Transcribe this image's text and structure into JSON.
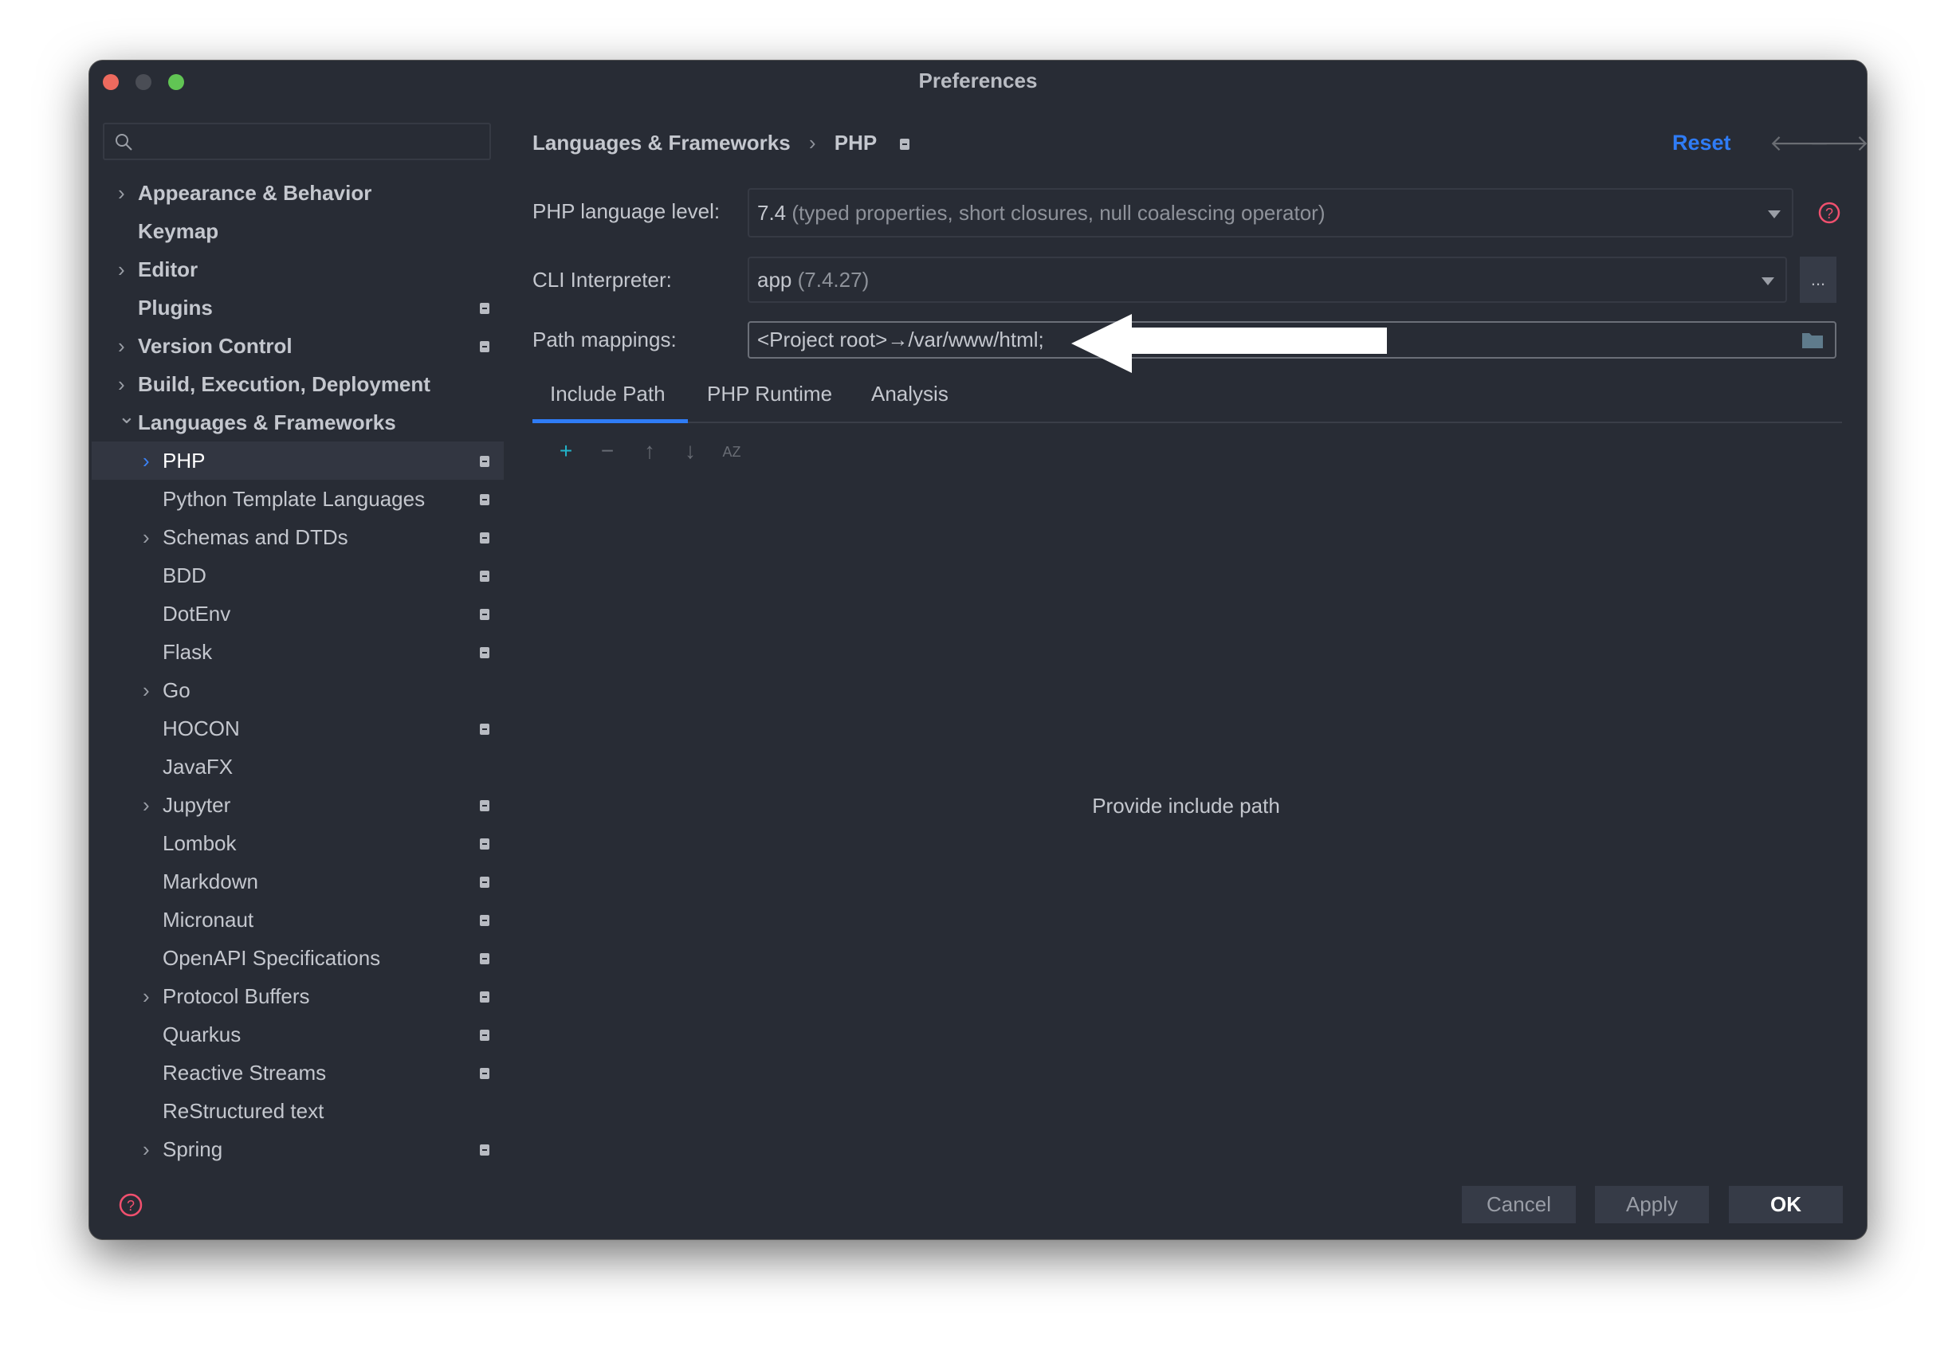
{
  "window": {
    "title": "Preferences"
  },
  "sidebar": {
    "search_placeholder": "",
    "items": [
      {
        "label": "Appearance & Behavior",
        "level": 0,
        "expander": "collapsed",
        "badge": false,
        "bold": true
      },
      {
        "label": "Keymap",
        "level": 0,
        "expander": "none",
        "badge": false,
        "bold": true
      },
      {
        "label": "Editor",
        "level": 0,
        "expander": "collapsed",
        "badge": false,
        "bold": true
      },
      {
        "label": "Plugins",
        "level": 0,
        "expander": "none",
        "badge": true,
        "bold": true
      },
      {
        "label": "Version Control",
        "level": 0,
        "expander": "collapsed",
        "badge": true,
        "bold": true
      },
      {
        "label": "Build, Execution, Deployment",
        "level": 0,
        "expander": "collapsed",
        "badge": false,
        "bold": true
      },
      {
        "label": "Languages & Frameworks",
        "level": 0,
        "expander": "expanded",
        "badge": false,
        "bold": true
      },
      {
        "label": "PHP",
        "level": 1,
        "expander": "collapsed",
        "badge": true,
        "selected": true
      },
      {
        "label": "Python Template Languages",
        "level": 1,
        "expander": "none",
        "badge": true
      },
      {
        "label": "Schemas and DTDs",
        "level": 1,
        "expander": "collapsed",
        "badge": true
      },
      {
        "label": "BDD",
        "level": 1,
        "expander": "none",
        "badge": true
      },
      {
        "label": "DotEnv",
        "level": 1,
        "expander": "none",
        "badge": true
      },
      {
        "label": "Flask",
        "level": 1,
        "expander": "none",
        "badge": true
      },
      {
        "label": "Go",
        "level": 1,
        "expander": "collapsed",
        "badge": false
      },
      {
        "label": "HOCON",
        "level": 1,
        "expander": "none",
        "badge": true
      },
      {
        "label": "JavaFX",
        "level": 1,
        "expander": "none",
        "badge": false
      },
      {
        "label": "Jupyter",
        "level": 1,
        "expander": "collapsed",
        "badge": true
      },
      {
        "label": "Lombok",
        "level": 1,
        "expander": "none",
        "badge": true
      },
      {
        "label": "Markdown",
        "level": 1,
        "expander": "none",
        "badge": true
      },
      {
        "label": "Micronaut",
        "level": 1,
        "expander": "none",
        "badge": true
      },
      {
        "label": "OpenAPI Specifications",
        "level": 1,
        "expander": "none",
        "badge": true
      },
      {
        "label": "Protocol Buffers",
        "level": 1,
        "expander": "collapsed",
        "badge": true
      },
      {
        "label": "Quarkus",
        "level": 1,
        "expander": "none",
        "badge": true
      },
      {
        "label": "Reactive Streams",
        "level": 1,
        "expander": "none",
        "badge": true
      },
      {
        "label": "ReStructured text",
        "level": 1,
        "expander": "none",
        "badge": false
      },
      {
        "label": "Spring",
        "level": 1,
        "expander": "collapsed",
        "badge": true
      }
    ]
  },
  "header": {
    "breadcrumb": [
      "Languages & Frameworks",
      "PHP"
    ],
    "reset_label": "Reset",
    "accent": "#2f7cf6"
  },
  "form": {
    "language_level_label": "PHP language level:",
    "language_level_value": "7.4",
    "language_level_desc": "(typed properties, short closures, null coalescing operator)",
    "cli_label": "CLI Interpreter:",
    "cli_value": "app",
    "cli_version": "(7.4.27)",
    "cli_more": "...",
    "path_label": "Path mappings:",
    "path_value": "<Project root>→/var/www/html;"
  },
  "tabs": [
    {
      "label": "Include Path",
      "active": true
    },
    {
      "label": "PHP Runtime"
    },
    {
      "label": "Analysis"
    }
  ],
  "toolbar": {
    "add": "+",
    "remove": "−",
    "up": "↑",
    "down": "↓",
    "sort": "AZ"
  },
  "empty_text": "Provide include path",
  "buttons": {
    "cancel": "Cancel",
    "apply": "Apply",
    "ok": "OK"
  }
}
